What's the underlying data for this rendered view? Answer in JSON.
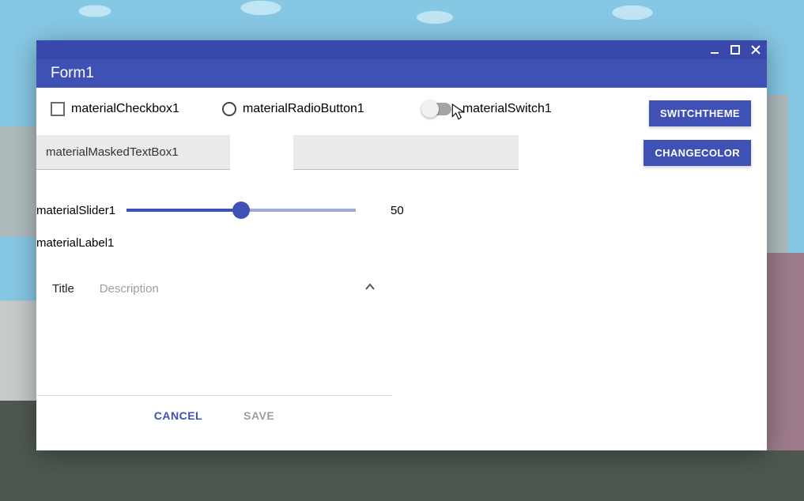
{
  "window": {
    "title": "Form1"
  },
  "controls": {
    "checkbox_label": "materialCheckbox1",
    "radio_label": "materialRadioButton1",
    "switch_label": "materialSwitch1",
    "masked_textbox_value": "materialMaskedTextBox1",
    "plain_textbox_value": "",
    "slider_label": "materialSlider1",
    "slider_value": "50",
    "slider_percent": 50,
    "label_text": "materialLabel1"
  },
  "buttons": {
    "switch_theme": "SWITCHTHEME",
    "change_color": "CHANGECOLOR"
  },
  "panel": {
    "title": "Title",
    "description": "Description",
    "cancel": "CANCEL",
    "save": "SAVE"
  },
  "colors": {
    "primary": "#3f51b5",
    "primary_dark": "#3949ab"
  }
}
